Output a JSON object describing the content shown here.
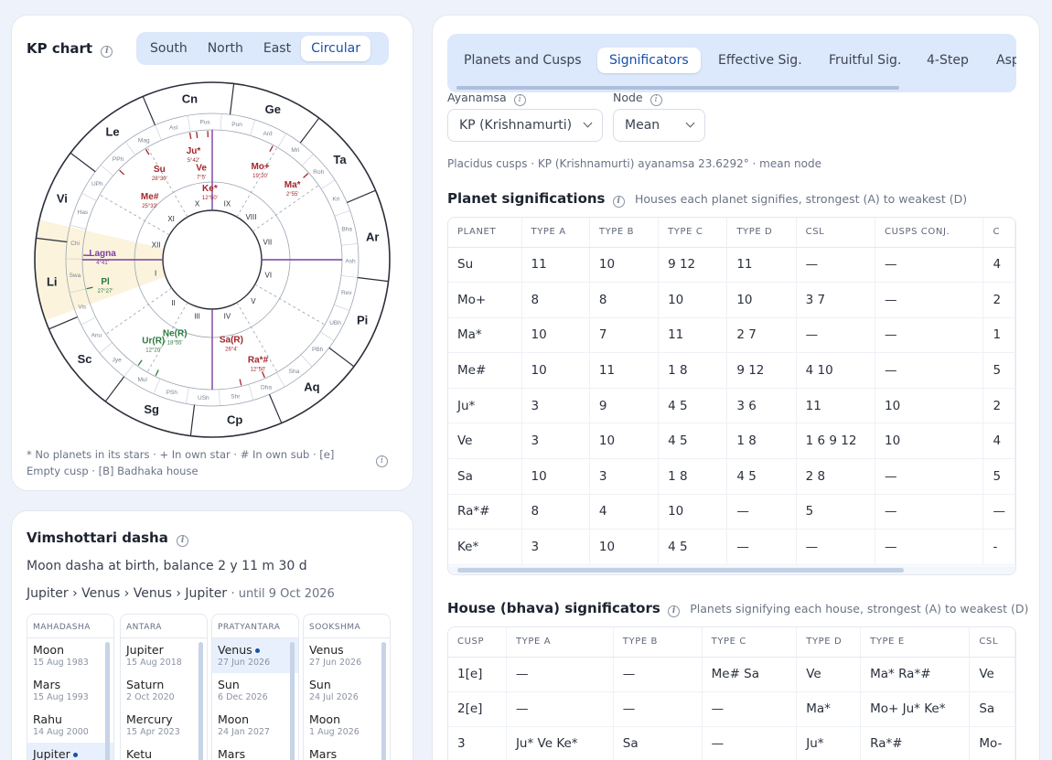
{
  "kp_card": {
    "title": "KP chart",
    "styles": [
      "South",
      "North",
      "East",
      "Circular"
    ],
    "active_style": "Circular",
    "legend": "* No planets in its stars · + In own star · # In own sub · [e] Empty cusp · [B] Badhaka house",
    "signs": [
      "Cn",
      "Ge",
      "Ta",
      "Ar",
      "Pi",
      "Aq",
      "Cp",
      "Sg",
      "Sc",
      "Li",
      "Vi",
      "Le"
    ],
    "nakshatras": [
      "Asl",
      "Pus",
      "Pun",
      "Ard",
      "Mri",
      "Roh",
      "Kri",
      "Bha",
      "Ash",
      "Rev",
      "UBh",
      "PBh",
      "Sha",
      "Dha",
      "Shr",
      "USh",
      "PSh",
      "Mul",
      "Jye",
      "Anu",
      "Vis",
      "Swa",
      "Chi",
      "Has",
      "UPh",
      "PPh",
      "Mag"
    ],
    "houses": [
      "I",
      "II",
      "III",
      "IV",
      "V",
      "VI",
      "VII",
      "VIII",
      "IX",
      "X",
      "XI",
      "XII"
    ],
    "planets": [
      {
        "label": "Ju*",
        "deg": "5°42'",
        "color": "#a3262b"
      },
      {
        "label": "Ve",
        "deg": "7°5'",
        "color": "#a3262b"
      },
      {
        "label": "Ke*",
        "deg": "12°50'",
        "color": "#a3262b"
      },
      {
        "label": "Su",
        "deg": "28°30'",
        "color": "#a3262b"
      },
      {
        "label": "Me#",
        "deg": "25°33'",
        "color": "#a3262b"
      },
      {
        "label": "Mo+",
        "deg": "19°20'",
        "color": "#a3262b"
      },
      {
        "label": "Ma*",
        "deg": "2°55'",
        "color": "#a3262b"
      },
      {
        "label": "Lagna",
        "deg": "4°41'",
        "color": "#7a3fa0"
      },
      {
        "label": "Pl",
        "deg": "27°27'",
        "color": "#2b7a3d"
      },
      {
        "label": "Sa(R)",
        "deg": "26°4'",
        "color": "#a3262b"
      },
      {
        "label": "Ne(R)",
        "deg": "18°55'",
        "color": "#2b7a3d"
      },
      {
        "label": "Ur(R)",
        "deg": "12°20'",
        "color": "#2b7a3d"
      },
      {
        "label": "Ra*#",
        "deg": "12°50'",
        "color": "#a3262b"
      }
    ]
  },
  "dasha": {
    "title": "Vimshottari dasha",
    "balance": "Moon dasha at birth, balance 2 y 11 m 30 d",
    "current_path": "Jupiter › Venus › Venus › Jupiter",
    "until": "· until 9 Oct 2026",
    "columns": [
      {
        "head": "MAHADASHA",
        "rows": [
          {
            "name": "Moon",
            "date": "15 Aug 1983"
          },
          {
            "name": "Mars",
            "date": "15 Aug 1993"
          },
          {
            "name": "Rahu",
            "date": "14 Aug 2000"
          },
          {
            "name": "Jupiter",
            "date": ""
          }
        ]
      },
      {
        "head": "ANTARA",
        "rows": [
          {
            "name": "Jupiter",
            "date": "15 Aug 2018"
          },
          {
            "name": "Saturn",
            "date": "2 Oct 2020"
          },
          {
            "name": "Mercury",
            "date": "15 Apr 2023"
          },
          {
            "name": "Ketu",
            "date": ""
          }
        ]
      },
      {
        "head": "PRATYANTARA",
        "rows": [
          {
            "name": "Venus",
            "date": "27 Jun 2026"
          },
          {
            "name": "Sun",
            "date": "6 Dec 2026"
          },
          {
            "name": "Moon",
            "date": "24 Jan 2027"
          },
          {
            "name": "Mars",
            "date": ""
          }
        ]
      },
      {
        "head": "SOOKSHMA",
        "rows": [
          {
            "name": "Venus",
            "date": "27 Jun 2026"
          },
          {
            "name": "Sun",
            "date": "24 Jul 2026"
          },
          {
            "name": "Moon",
            "date": "1 Aug 2026"
          },
          {
            "name": "Mars",
            "date": ""
          }
        ]
      }
    ]
  },
  "right": {
    "tabs": [
      "Planets and Cusps",
      "Significators",
      "Effective Sig.",
      "Fruitful Sig.",
      "4-Step",
      "Asp"
    ],
    "active_tab": "Significators",
    "ayanamsa_label": "Ayanamsa",
    "ayanamsa_value": "KP (Krishnamurti)",
    "node_label": "Node",
    "node_value": "Mean",
    "note": "Placidus cusps · KP (Krishnamurti) ayanamsa 23.6292° · mean node",
    "planet_sig": {
      "title": "Planet significations",
      "subtitle": "Houses each planet signifies, strongest (A) to weakest (D)",
      "headers": [
        "PLANET",
        "TYPE A",
        "TYPE B",
        "TYPE C",
        "TYPE D",
        "CSL",
        "CUSPS CONJ.",
        "C"
      ],
      "rows": [
        [
          "Su",
          "11",
          "10",
          "9 12",
          "11",
          "—",
          "—",
          "4"
        ],
        [
          "Mo+",
          "8",
          "8",
          "10",
          "10",
          "3 7",
          "—",
          "2"
        ],
        [
          "Ma*",
          "10",
          "7",
          "11",
          "2 7",
          "—",
          "—",
          "1"
        ],
        [
          "Me#",
          "10",
          "11",
          "1 8",
          "9 12",
          "4 10",
          "—",
          "5"
        ],
        [
          "Ju*",
          "3",
          "9",
          "4 5",
          "3 6",
          "11",
          "10",
          "2"
        ],
        [
          "Ve",
          "3",
          "10",
          "4 5",
          "1 8",
          "1 6 9 12",
          "10",
          "4"
        ],
        [
          "Sa",
          "10",
          "3",
          "1 8",
          "4 5",
          "2 8",
          "—",
          "5"
        ],
        [
          "Ra*#",
          "8",
          "4",
          "10",
          "—",
          "5",
          "—",
          "—"
        ],
        [
          "Ke*",
          "3",
          "10",
          "4 5",
          "—",
          "—",
          "—",
          "-"
        ]
      ]
    },
    "house_sig": {
      "title": "House (bhava) significators",
      "subtitle": "Planets signifying each house, strongest (A) to weakest (D)",
      "headers": [
        "CUSP",
        "TYPE A",
        "TYPE B",
        "TYPE C",
        "TYPE D",
        "TYPE E",
        "CSL"
      ],
      "rows": [
        [
          "1[e]",
          "—",
          "—",
          "Me# Sa",
          "Ve",
          "Ma* Ra*#",
          "Ve"
        ],
        [
          "2[e]",
          "—",
          "—",
          "—",
          "Ma*",
          "Mo+ Ju* Ke*",
          "Sa"
        ],
        [
          "3",
          "Ju* Ve Ke*",
          "Sa",
          "—",
          "Ju*",
          "Ra*#",
          "Mo-"
        ]
      ]
    }
  },
  "colors": {
    "accent": "#1a4fa8",
    "segment_bg": "#dce8fb",
    "planet_red": "#a3262b",
    "planet_green": "#2b7a3d",
    "lagna_purple": "#7a3fa0",
    "asc_highlight": "#fbf3dc"
  }
}
